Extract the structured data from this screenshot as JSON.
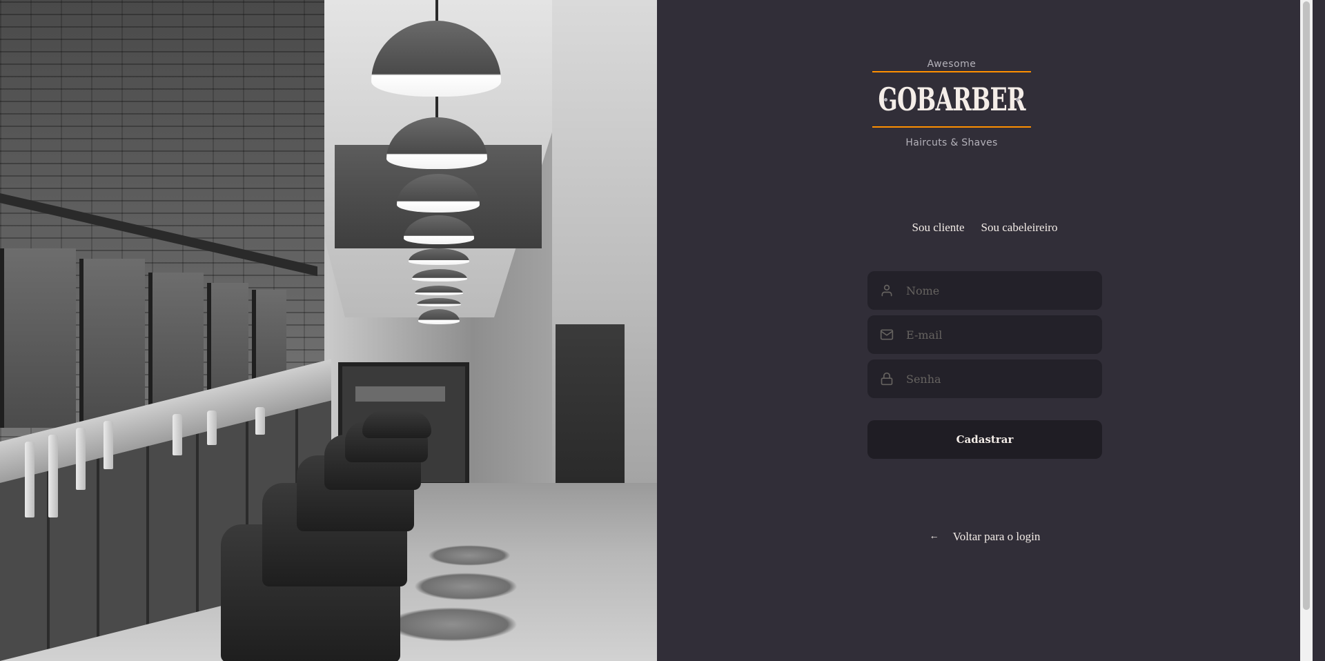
{
  "brand": {
    "top_text": "Awesome",
    "title": "GoBarber",
    "subtitle": "Haircuts & Shaves",
    "accent_color": "#ff9000"
  },
  "tabs": [
    {
      "label": "Sou cliente"
    },
    {
      "label": "Sou cabeleireiro"
    }
  ],
  "form": {
    "name_placeholder": "Nome",
    "email_placeholder": "E-mail",
    "password_placeholder": "Senha",
    "submit_label": "Cadastrar"
  },
  "icons": {
    "name": "user-icon",
    "email": "mail-icon",
    "password": "lock-icon",
    "back": "arrow-left-icon"
  },
  "back_link": {
    "arrow": "←",
    "label": "Voltar para o login"
  },
  "colors": {
    "background": "#312e38",
    "input_background": "#232129",
    "placeholder": "#666360",
    "text": "#f4ede8"
  }
}
